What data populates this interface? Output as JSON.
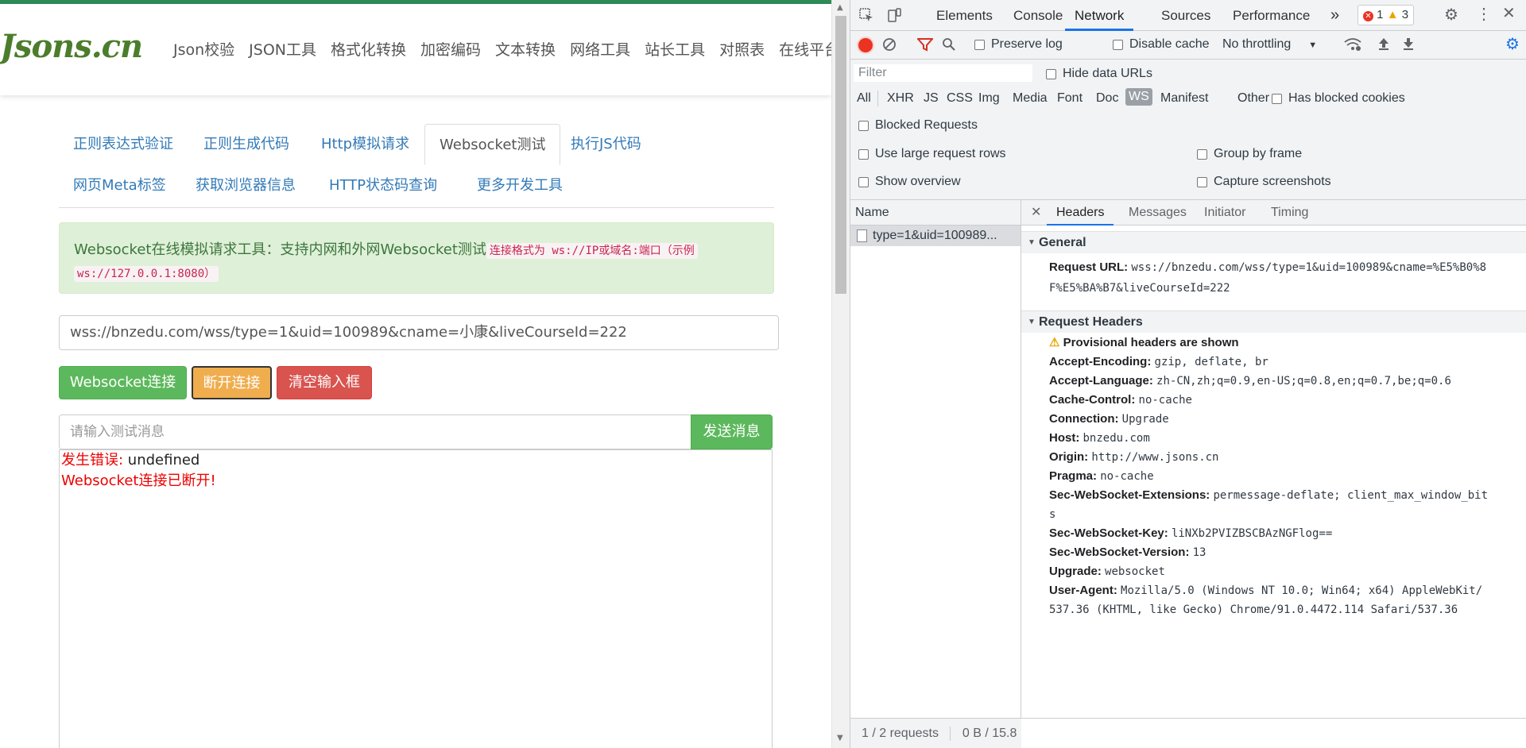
{
  "site": {
    "logo": "Jsons.cn",
    "nav": [
      "Json校验",
      "JSON工具",
      "格式化转换",
      "加密编码",
      "文本转换",
      "网络工具",
      "站长工具",
      "对照表",
      "在线平台"
    ]
  },
  "tools": {
    "tabs": [
      "正则表达式验证",
      "正则生成代码",
      "Http模拟请求",
      "Websocket测试",
      "执行JS代码",
      "网页Meta标签",
      "获取浏览器信息",
      "HTTP状态码查询",
      "更多开发工具"
    ],
    "active_tab": "Websocket测试"
  },
  "notice": {
    "text": "Websocket在线模拟请求工具：支持内网和外网Websocket测试",
    "format_prefix": "连接格式为 ",
    "format_code": "ws://IP或域名:端口（示例",
    "example_code": "ws://127.0.0.1:8080）"
  },
  "form": {
    "url_value": "wss://bnzedu.com/wss/type=1&uid=100989&cname=小康&liveCourseId=222",
    "connect_label": "Websocket连接",
    "disconnect_label": "断开连接",
    "clear_label": "清空输入框",
    "message_placeholder": "请输入测试消息",
    "send_label": "发送消息"
  },
  "log": {
    "error_prefix": "发生错误:",
    "error_value": " undefined",
    "disconnected": "Websocket连接已断开!"
  },
  "devtools": {
    "tabs": [
      "Elements",
      "Console",
      "Network",
      "Sources",
      "Performance"
    ],
    "active_tab": "Network",
    "more": "»",
    "error_count": "1",
    "warning_count": "3",
    "toolbar": {
      "preserve_log": "Preserve log",
      "disable_cache": "Disable cache",
      "throttling": "No throttling"
    },
    "filter_placeholder": "Filter",
    "hide_data_urls": "Hide data URLs",
    "types": [
      "All",
      "XHR",
      "JS",
      "CSS",
      "Img",
      "Media",
      "Font",
      "Doc",
      "WS",
      "Manifest",
      "Other"
    ],
    "active_type": "WS",
    "has_blocked_cookies": "Has blocked cookies",
    "blocked_requests": "Blocked Requests",
    "settings": {
      "large_rows": "Use large request rows",
      "group_by_frame": "Group by frame",
      "show_overview": "Show overview",
      "capture_screenshots": "Capture screenshots"
    },
    "name_header": "Name",
    "request_name": "type=1&uid=100989...",
    "detail_tabs": [
      "Headers",
      "Messages",
      "Initiator",
      "Timing"
    ],
    "active_detail_tab": "Headers",
    "general_title": "General",
    "request_url_key": "Request URL:",
    "request_url_line1": "wss://bnzedu.com/wss/type=1&uid=100989&cname=%E5%B0%8",
    "request_url_line2": "F%E5%BA%B7&liveCourseId=222",
    "request_headers_title": "Request Headers",
    "provisional": "Provisional headers are shown",
    "headers": [
      {
        "k": "Accept-Encoding:",
        "v": "gzip, deflate, br"
      },
      {
        "k": "Accept-Language:",
        "v": "zh-CN,zh;q=0.9,en-US;q=0.8,en;q=0.7,be;q=0.6"
      },
      {
        "k": "Cache-Control:",
        "v": "no-cache"
      },
      {
        "k": "Connection:",
        "v": "Upgrade"
      },
      {
        "k": "Host:",
        "v": "bnzedu.com"
      },
      {
        "k": "Origin:",
        "v": "http://www.jsons.cn"
      },
      {
        "k": "Pragma:",
        "v": "no-cache"
      },
      {
        "k": "Sec-WebSocket-Extensions:",
        "v": "permessage-deflate; client_max_window_bit"
      },
      {
        "k": "",
        "v": "s"
      },
      {
        "k": "Sec-WebSocket-Key:",
        "v": "liNXb2PVIZBSCBAzNGFlog=="
      },
      {
        "k": "Sec-WebSocket-Version:",
        "v": "13"
      },
      {
        "k": "Upgrade:",
        "v": "websocket"
      },
      {
        "k": "User-Agent:",
        "v": "Mozilla/5.0 (Windows NT 10.0; Win64; x64) AppleWebKit/"
      },
      {
        "k": "",
        "v": "537.36 (KHTML, like Gecko) Chrome/91.0.4472.114 Safari/537.36"
      }
    ],
    "status_requests": "1 / 2 requests",
    "status_size": "0 B / 15.8"
  },
  "colors": {
    "brand_green": "#4b7d2b",
    "success": "#5cb85c",
    "warning": "#f0ad4e",
    "danger": "#d9534f",
    "devtools_accent": "#1a73e8",
    "record_red": "#ea3323"
  }
}
